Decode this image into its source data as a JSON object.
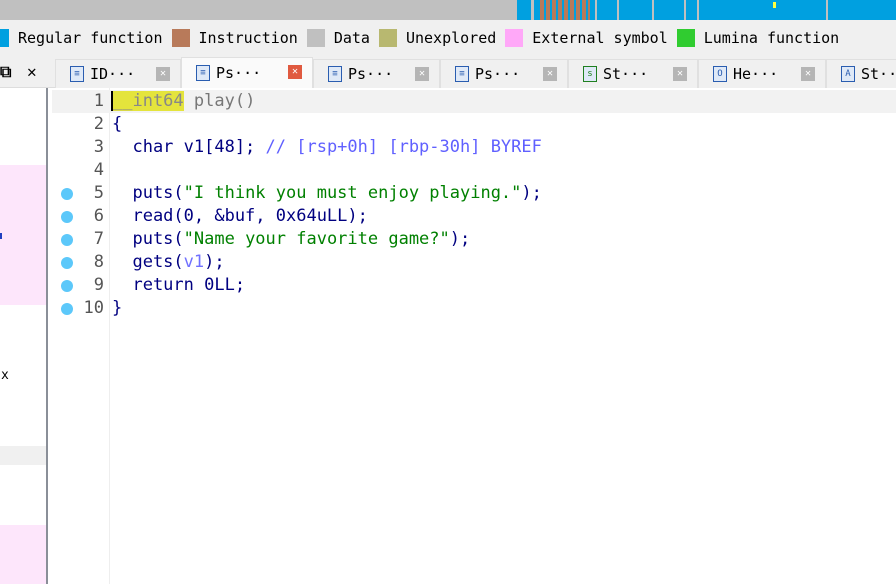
{
  "legend": [
    {
      "label": "Regular function",
      "color": "#00a0e0"
    },
    {
      "label": "Instruction",
      "color": "#b87a5a"
    },
    {
      "label": "Data",
      "color": "#c0c0c0"
    },
    {
      "label": "Unexplored",
      "color": "#b8b870"
    },
    {
      "label": "External symbol",
      "color": "#ffa8f8"
    },
    {
      "label": "Lumina function",
      "color": "#30cc30"
    }
  ],
  "tabs": [
    {
      "label": "ID···",
      "icon": "≡"
    },
    {
      "label": "Ps···",
      "icon": "≡"
    },
    {
      "label": "Ps···",
      "icon": "≡"
    },
    {
      "label": "Ps···",
      "icon": "≡"
    },
    {
      "label": "St···",
      "icon": "s"
    },
    {
      "label": "He···",
      "icon": "O"
    },
    {
      "label": "St···",
      "icon": "A"
    }
  ],
  "left_panel": {
    "x_char": "x"
  },
  "code": {
    "l1a": "__int64",
    "l1b": " play()",
    "l2": "{",
    "l3a": "  char v1[48]; ",
    "l3b": "// [rsp+0h] [rbp-30h] BYREF",
    "l5a": "  puts(",
    "l5b": "\"I think you must enjoy playing.\"",
    "l5c": ");",
    "l6": "  read(0, &buf, 0x64uLL);",
    "l7a": "  puts(",
    "l7b": "\"Name your favorite game?\"",
    "l7c": ");",
    "l8a": "  gets(",
    "l8b": "v1",
    "l8c": ");",
    "l9": "  return 0LL;",
    "l10": "}"
  },
  "line_numbers": [
    "1",
    "2",
    "3",
    "4",
    "5",
    "6",
    "7",
    "8",
    "9",
    "10"
  ]
}
